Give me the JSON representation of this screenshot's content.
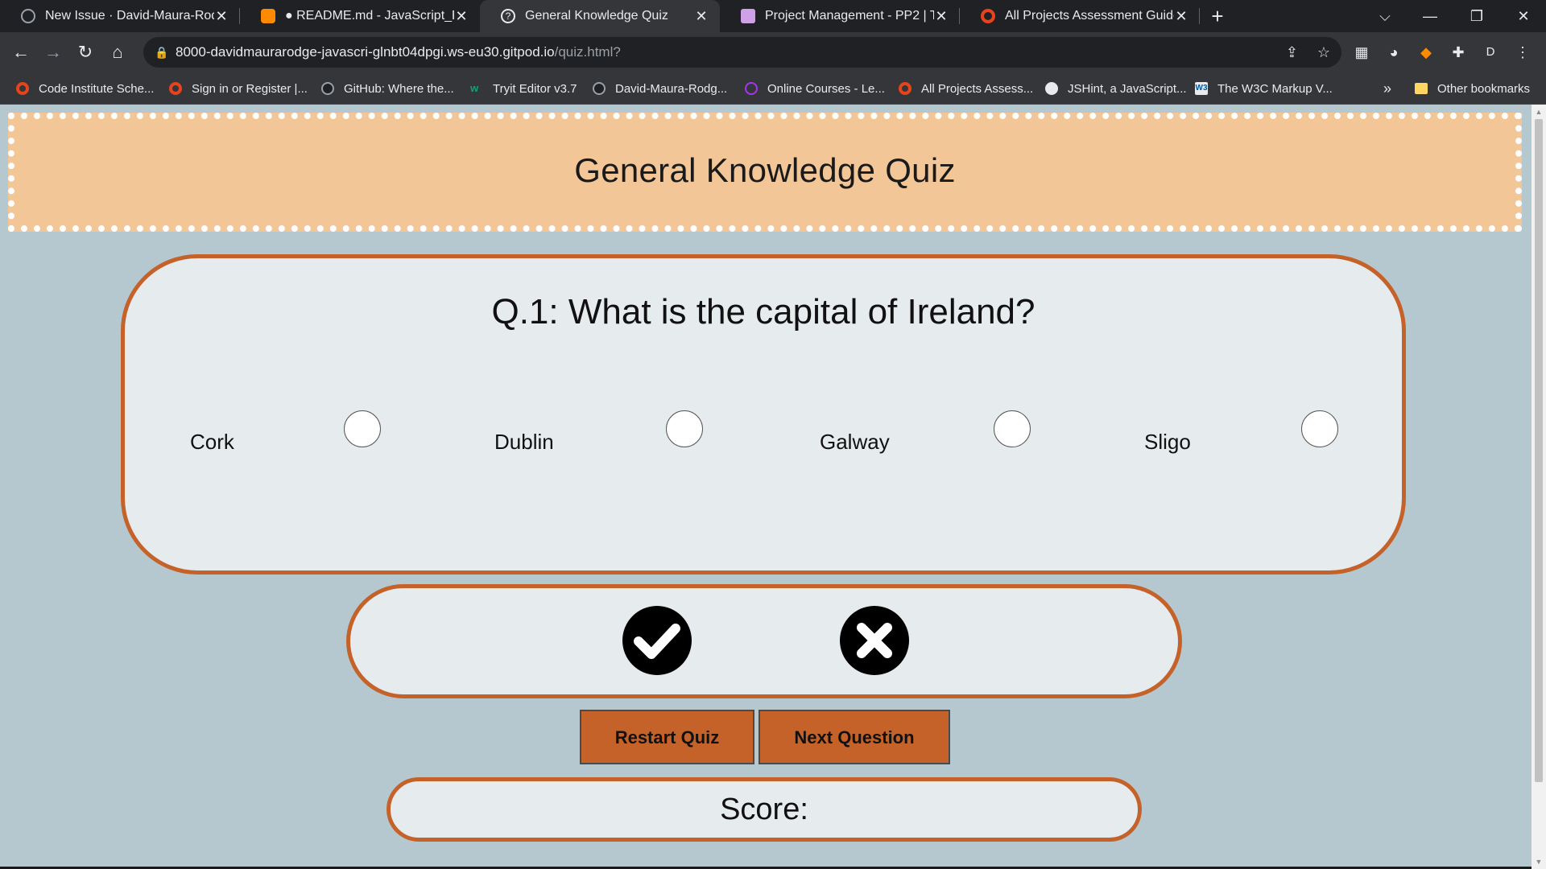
{
  "browser": {
    "tabs": [
      {
        "title": "New Issue · David-Maura-Rodger",
        "icon": "github-icon",
        "active": false
      },
      {
        "title": "● README.md - JavaScript_Proje",
        "icon": "gitpod-icon",
        "active": false
      },
      {
        "title": "General Knowledge Quiz",
        "icon": "question-circle-icon",
        "active": true
      },
      {
        "title": "Project Management - PP2 | Trell",
        "icon": "trello-icon",
        "active": false
      },
      {
        "title": "All Projects Assessment Guide | A",
        "icon": "code-institute-icon",
        "active": false
      }
    ],
    "url_host": "8000-davidmaurarodge-javascri-glnbt04dpgi.ws-eu30.gitpod.io",
    "url_path": "/quiz.html?",
    "profile_initial": "D",
    "bookmarks": [
      {
        "label": "Code Institute Sche...",
        "icon": "code-institute-icon"
      },
      {
        "label": "Sign in or Register |...",
        "icon": "code-institute-icon"
      },
      {
        "label": "GitHub: Where the...",
        "icon": "github-icon"
      },
      {
        "label": "Tryit Editor v3.7",
        "icon": "w3schools-icon"
      },
      {
        "label": "David-Maura-Rodg...",
        "icon": "github-icon"
      },
      {
        "label": "Online Courses - Le...",
        "icon": "udemy-icon"
      },
      {
        "label": "All Projects Assess...",
        "icon": "code-institute-icon"
      },
      {
        "label": "JSHint, a JavaScript...",
        "icon": "globe-icon"
      },
      {
        "label": "The W3C Markup V...",
        "icon": "w3c-icon"
      }
    ],
    "bookmarks_overflow": "»",
    "other_bookmarks": "Other bookmarks"
  },
  "page": {
    "title": "General Knowledge Quiz",
    "question": "Q.1: What is the capital of Ireland?",
    "answers": [
      "Cork",
      "Dublin",
      "Galway",
      "Sligo"
    ],
    "buttons": {
      "restart": "Restart Quiz",
      "next": "Next Question"
    },
    "score_label": "Score:"
  },
  "colors": {
    "page_background": "#b6c8cf",
    "header_background": "#f2c697",
    "card_border": "#c4622a",
    "card_background": "#e6ebee",
    "button_background": "#c4622a"
  }
}
